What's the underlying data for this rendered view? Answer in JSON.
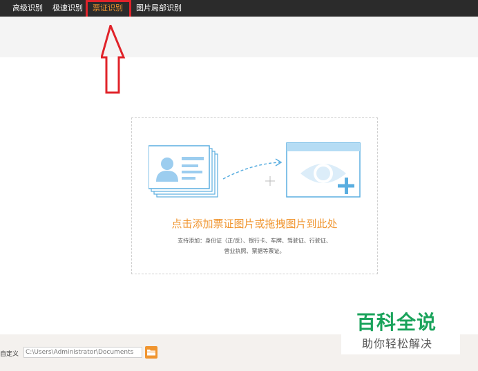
{
  "tabs": [
    {
      "label": "高级识别",
      "active": false
    },
    {
      "label": "极速识别",
      "active": false
    },
    {
      "label": "票证识别",
      "active": true
    },
    {
      "label": "图片局部识别",
      "active": false
    }
  ],
  "dropzone": {
    "title": "点击添加票证图片或拖拽图片到此处",
    "support_line1": "支持添加：身份证（正/反）、银行卡、车牌、驾驶证、行驶证、",
    "support_line2": "营业执照、票据等票证。"
  },
  "bottom": {
    "custom_label": "自定义",
    "path_value": "C:\\Users\\Administrator\\Documents"
  },
  "watermark": {
    "title": "百科全说",
    "subtitle": "助你轻松解决"
  },
  "colors": {
    "accent": "#f0952f",
    "highlight": "#e0232a",
    "topbar": "#2b2b2b",
    "illustration": "#5aaee0",
    "watermark_green": "#1aa35b"
  },
  "icons": [
    "id-card-icon",
    "eye-plus-icon",
    "move-cursor-icon",
    "folder-icon",
    "up-arrow-annotation"
  ]
}
